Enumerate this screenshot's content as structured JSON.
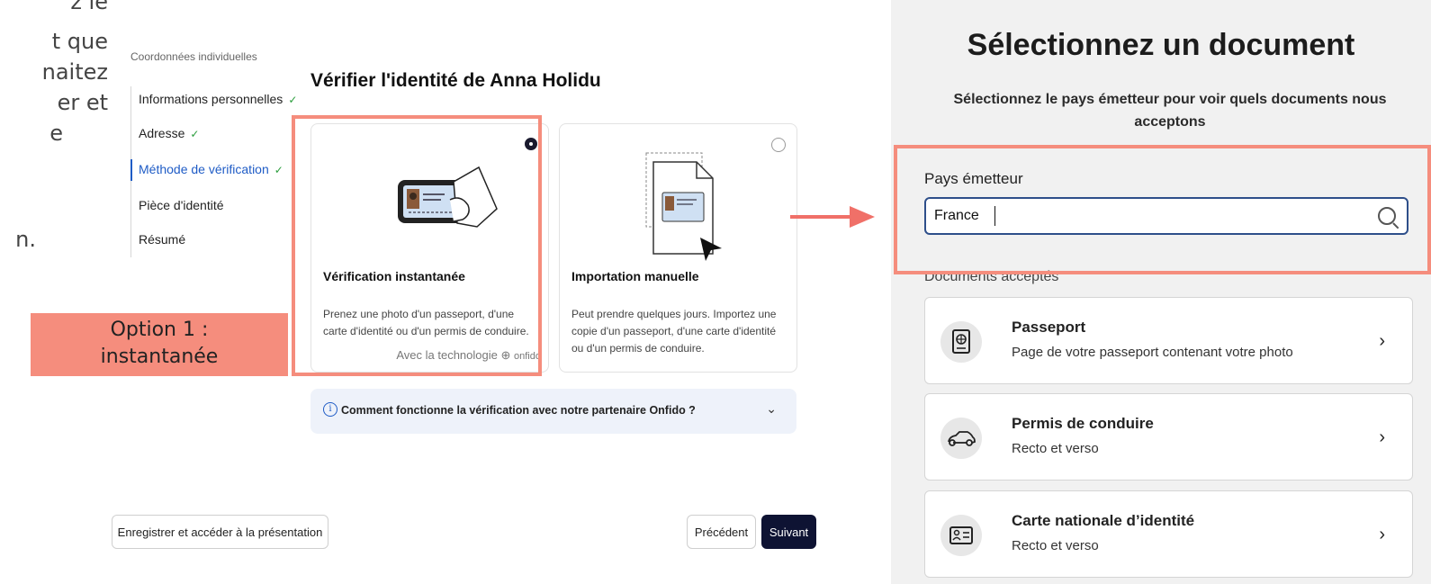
{
  "left_text": {
    "lines": [
      "z le",
      "t que",
      "naitez",
      "er et",
      "e",
      "",
      "n."
    ]
  },
  "stepper": {
    "header": "Coordonnées individuelles",
    "steps": [
      {
        "label": "Informations personnelles",
        "done": true,
        "active": false
      },
      {
        "label": "Adresse",
        "done": true,
        "active": false
      },
      {
        "label": "Méthode de vérification",
        "done": true,
        "active": true
      },
      {
        "label": "Pièce d'identité",
        "done": false,
        "active": false
      },
      {
        "label": "Résumé",
        "done": false,
        "active": false
      }
    ],
    "check_glyph": "✓"
  },
  "main": {
    "title": "Vérifier l'identité de Anna Holidu",
    "options": [
      {
        "title": "Vérification instantanée",
        "description": "Prenez une photo d'un passeport, d'une carte d'identité ou d'un permis de conduire.",
        "selected": true,
        "tech_label": "Avec la technologie",
        "tech_brand": "onfido"
      },
      {
        "title": "Importation manuelle",
        "description": "Peut prendre quelques jours. Importez une copie d'un passeport, d'une carte d'identité ou d'un permis de conduire.",
        "selected": false
      }
    ],
    "info_text": "Comment fonctionne la vérification avec notre partenaire Onfido ?",
    "info_icon": "i"
  },
  "annotation": {
    "option_label": "Option 1 :\ninstantanée",
    "color": "#f58d7d"
  },
  "footer": {
    "save_label": "Enregistrer et accéder à la présentation",
    "prev_label": "Précédent",
    "next_label": "Suivant"
  },
  "document_panel": {
    "title": "Sélectionnez un document",
    "subtitle": "Sélectionnez le pays émetteur pour voir quels documents nous acceptons",
    "country_label": "Pays émetteur",
    "country_value": "France",
    "accepted_label": "Documents acceptés",
    "documents": [
      {
        "title": "Passeport",
        "description": "Page de votre passeport contenant votre photo",
        "icon": "passport-icon"
      },
      {
        "title": "Permis de conduire",
        "description": "Recto et verso",
        "icon": "car-icon"
      },
      {
        "title": "Carte nationale d’identité",
        "description": "Recto et verso",
        "icon": "id-card-icon"
      }
    ]
  },
  "colors": {
    "accent_blue": "#1f5cc6",
    "primary_button": "#0e1333",
    "highlight": "#f58d7d",
    "arrow": "#f07068"
  }
}
